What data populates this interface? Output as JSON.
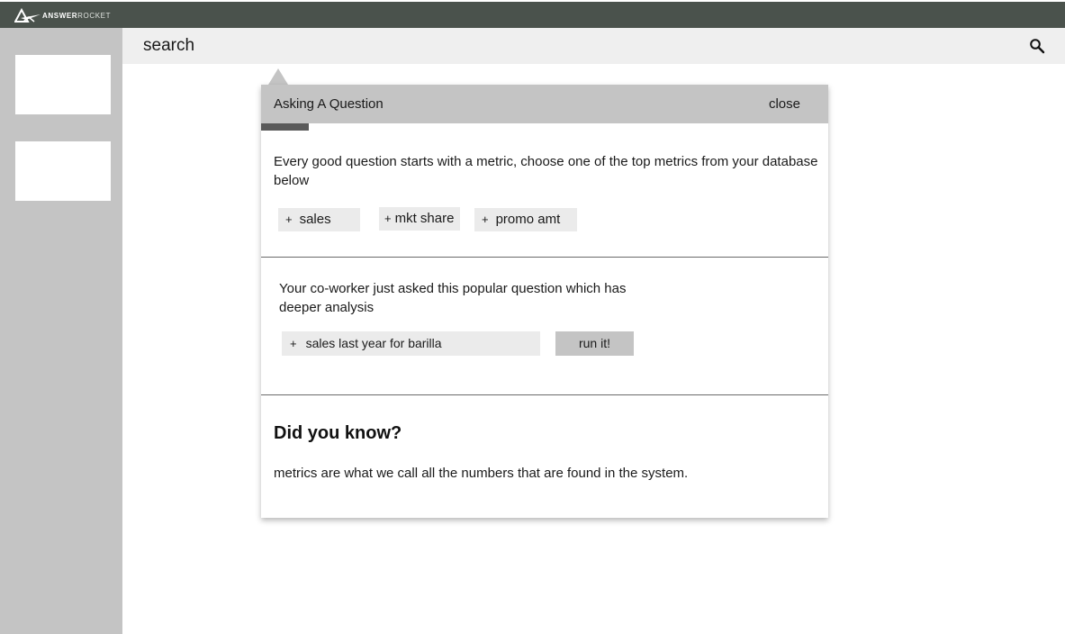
{
  "app": {
    "logo_text_bold": "ANSWER",
    "logo_text_light": "ROCKET"
  },
  "search": {
    "label": "search",
    "icon": "magnifier-icon"
  },
  "panel": {
    "title": "Asking A Question",
    "close_label": "close",
    "metrics_section": {
      "text": "Every good question starts with a metric, choose one of the top metrics from your database below",
      "chips": [
        {
          "plus": "+",
          "label": "sales"
        },
        {
          "plus": "+",
          "label": "mkt share"
        },
        {
          "plus": "+",
          "label": "promo amt"
        }
      ]
    },
    "popular_section": {
      "text_line1": "Your co-worker just asked this popular question which has",
      "text_line2": "deeper analysis",
      "question_plus": "+",
      "question": "sales last year for barilla",
      "run_label": "run it!"
    },
    "tip_section": {
      "heading": "Did you know?",
      "text": "metrics are what we call all the numbers that are found in the system."
    }
  },
  "colors": {
    "topbar": "#4a524c",
    "sidebar": "#c4c4c4",
    "searchbar": "#efefef",
    "panel_header": "#c4c4c4",
    "chip": "#ebebeb",
    "progress": "#5a5a5a"
  }
}
